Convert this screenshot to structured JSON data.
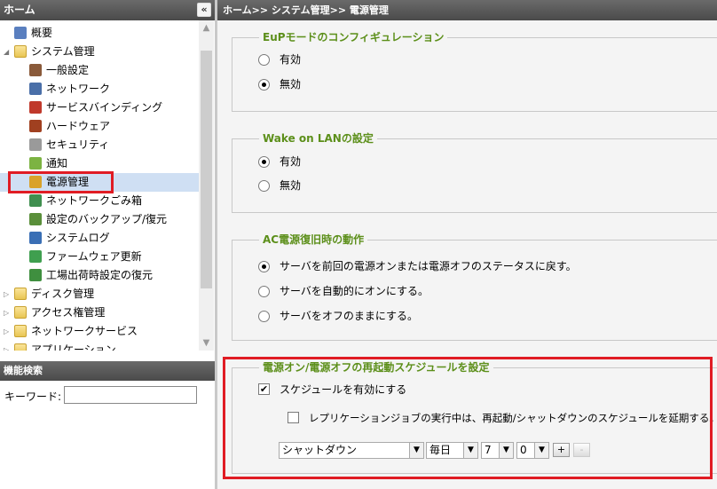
{
  "left_panel": {
    "title": "ホーム",
    "collapse_glyph": "«",
    "tree": [
      {
        "label": "概要",
        "level": 1,
        "icon": "overview-icon",
        "color": "#5a7fbf"
      },
      {
        "label": "システム管理",
        "level": 0,
        "icon": "folder-icon",
        "expanded": true
      },
      {
        "label": "一般設定",
        "level": 1,
        "icon": "general-settings-icon",
        "color": "#8a5a3a"
      },
      {
        "label": "ネットワーク",
        "level": 1,
        "icon": "network-icon",
        "color": "#4a6fa8"
      },
      {
        "label": "サービスバインディング",
        "level": 1,
        "icon": "service-binding-icon",
        "color": "#c0392b"
      },
      {
        "label": "ハードウェア",
        "level": 1,
        "icon": "hardware-icon",
        "color": "#a04020"
      },
      {
        "label": "セキュリティ",
        "level": 1,
        "icon": "security-icon",
        "color": "#9a9a9a"
      },
      {
        "label": "通知",
        "level": 1,
        "icon": "notification-icon",
        "color": "#7cb342"
      },
      {
        "label": "電源管理",
        "level": 1,
        "icon": "power-management-icon",
        "color": "#d9a22a",
        "selected": true
      },
      {
        "label": "ネットワークごみ箱",
        "level": 1,
        "icon": "network-recycle-bin-icon",
        "color": "#3f8f4f"
      },
      {
        "label": "設定のバックアップ/復元",
        "level": 1,
        "icon": "backup-restore-icon",
        "color": "#5a8f3a"
      },
      {
        "label": "システムログ",
        "level": 1,
        "icon": "system-log-icon",
        "color": "#3a6fb5"
      },
      {
        "label": "ファームウェア更新",
        "level": 1,
        "icon": "firmware-update-icon",
        "color": "#3f9f4f"
      },
      {
        "label": "工場出荷時設定の復元",
        "level": 1,
        "icon": "factory-reset-icon",
        "color": "#3f8f3f"
      },
      {
        "label": "ディスク管理",
        "level": 0,
        "icon": "folder-icon"
      },
      {
        "label": "アクセス権管理",
        "level": 0,
        "icon": "folder-icon"
      },
      {
        "label": "ネットワークサービス",
        "level": 0,
        "icon": "folder-icon"
      },
      {
        "label": "アプリケーション",
        "level": 0,
        "icon": "folder-icon"
      }
    ],
    "search": {
      "title": "機能検索",
      "keyword_label": "キーワード:",
      "keyword_value": ""
    }
  },
  "breadcrumb": "ホーム>> システム管理>> 電源管理",
  "eup": {
    "title": "EuPモードのコンフィギュレーション",
    "options": [
      {
        "label": "有効",
        "selected": false
      },
      {
        "label": "無効",
        "selected": true
      }
    ]
  },
  "wol": {
    "title": "Wake on LANの設定",
    "options": [
      {
        "label": "有効",
        "selected": true
      },
      {
        "label": "無効",
        "selected": false
      }
    ]
  },
  "ac": {
    "title": "AC電源復旧時の動作",
    "options": [
      {
        "label": "サーバを前回の電源オンまたは電源オフのステータスに戻す。",
        "selected": true
      },
      {
        "label": "サーバを自動的にオンにする。",
        "selected": false
      },
      {
        "label": "サーバをオフのままにする。",
        "selected": false
      }
    ]
  },
  "schedule": {
    "title": "電源オン/電源オフの再起動スケジュールを設定",
    "enable_label": "スケジュールを有効にする",
    "enable_checked": true,
    "postpone_label": "レプリケーションジョブの実行中は、再起動/シャットダウンのスケジュールを延期する。",
    "postpone_checked": false,
    "action": "シャットダウン",
    "day": "毎日",
    "hour": "7",
    "minute": "0",
    "add_label": "+",
    "remove_label": "-"
  },
  "colors": {
    "legend_green": "#5c8f1a",
    "highlight_red": "#e01c24",
    "selected_row": "#cfdff3"
  }
}
